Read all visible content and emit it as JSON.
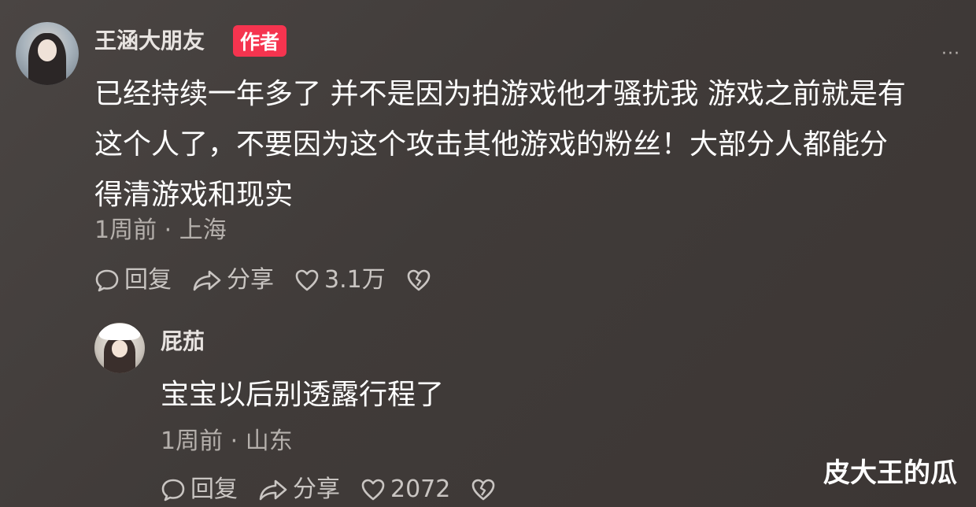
{
  "comments": [
    {
      "user": "王涵大朋友",
      "author_badge": "作者",
      "text": "已经持续一年多了 并不是因为拍游戏他才骚扰我 游戏之前就是有\n这个人了，不要因为这个攻击其他游戏的粉丝！大部分人都能分\n得清游戏和现实",
      "time": "1周前",
      "location": "上海",
      "reply_label": "回复",
      "share_label": "分享",
      "like_count": "3.1万",
      "more_icon": "more-dots-icon"
    },
    {
      "user": "屁茄",
      "text": "宝宝以后别透露行程了",
      "time": "1周前",
      "location": "山东",
      "reply_label": "回复",
      "share_label": "分享",
      "like_count": "2072"
    }
  ],
  "watermark": "皮大王的瓜",
  "colors": {
    "background": "#423d3b",
    "author_badge": "#f5344f",
    "meta_text": "#b5b0ac"
  }
}
